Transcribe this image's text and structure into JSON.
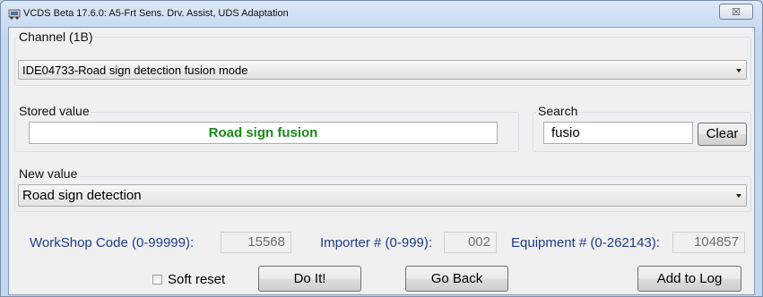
{
  "window": {
    "title": "VCDS Beta 17.6.0: A5-Frt Sens. Drv. Assist,  UDS Adaptation",
    "close_glyph": "☒"
  },
  "channel": {
    "label": "Channel (1B)",
    "selected": "IDE04733-Road sign detection fusion mode"
  },
  "stored_value": {
    "label": "Stored value",
    "value": "Road sign fusion",
    "value_color": "#1a8a1a"
  },
  "search": {
    "label": "Search",
    "value": "fusio",
    "clear_label": "Clear"
  },
  "new_value": {
    "label": "New value",
    "selected": "Road sign detection"
  },
  "workshop": {
    "label": "WorkShop Code (0-99999):",
    "value": "15568"
  },
  "importer": {
    "label": "Importer # (0-999):",
    "value": "002"
  },
  "equipment": {
    "label": "Equipment # (0-262143):",
    "value": "104857"
  },
  "actions": {
    "soft_reset_label": "Soft reset",
    "soft_reset_checked": false,
    "do_it_label": "Do It!",
    "go_back_label": "Go Back",
    "add_to_log_label": "Add to Log"
  },
  "colors": {
    "label_blue": "#1e3c8c",
    "stored_green": "#1a8a1a"
  }
}
